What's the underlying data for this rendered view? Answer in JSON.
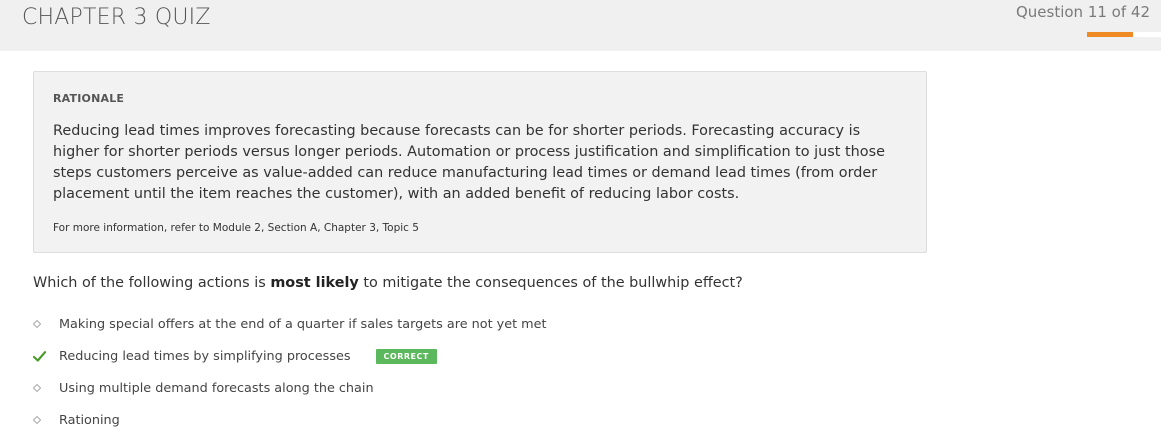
{
  "header": {
    "title": "CHAPTER 3 QUIZ",
    "question_counter": "Question 11 of 42",
    "progress": 0.62,
    "accent_color": "#f08a24"
  },
  "rationale": {
    "heading": "RATIONALE",
    "body": "Reducing lead times improves forecasting because forecasts can be for shorter periods. Forecasting accuracy is higher for shorter periods versus longer periods. Automation or process justification and simplification to just those steps customers perceive as value-added can reduce manufacturing lead times or demand lead times (from order placement until the item reaches the customer), with an added benefit of reducing labor costs.",
    "reference": "For more information, refer to Module 2, Section A, Chapter 3, Topic 5"
  },
  "question": {
    "prefix": "Which of the following actions is ",
    "emphasis": "most likely",
    "suffix": " to mitigate the consequences of the bullwhip effect?"
  },
  "options": [
    {
      "label": "Making special offers at the end of a quarter if sales targets are not yet met",
      "icon": "diamond-bullet-icon"
    },
    {
      "label": "Reducing lead times by simplifying processes",
      "icon": "checkmark-icon",
      "badge": "CORRECT"
    },
    {
      "label": "Using multiple demand forecasts along the chain",
      "icon": "diamond-bullet-icon"
    },
    {
      "label": "Rationing",
      "icon": "diamond-bullet-icon"
    }
  ],
  "colors": {
    "correct": "#5cb85c",
    "check": "#4a9a2c"
  }
}
